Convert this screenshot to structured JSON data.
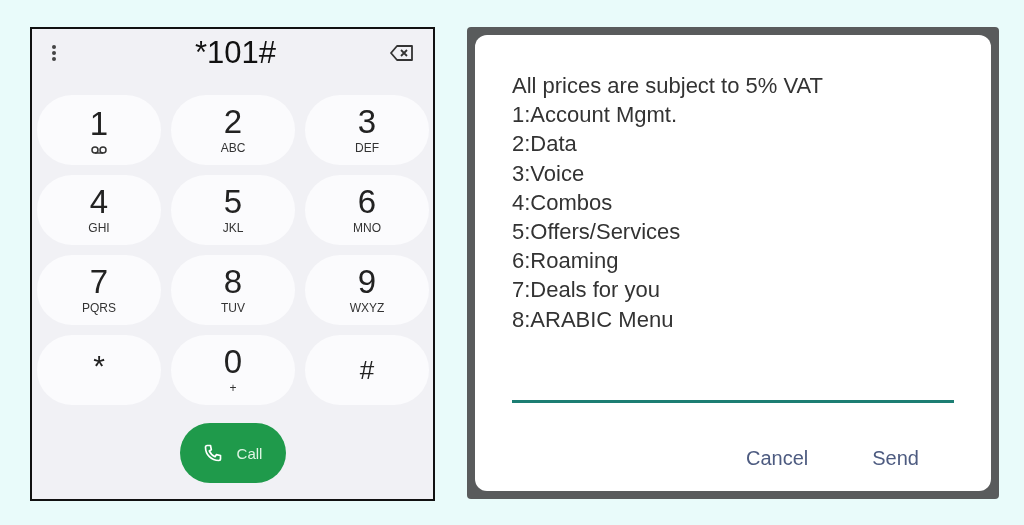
{
  "dialer": {
    "number": "*101#",
    "keys": [
      {
        "digit": "1",
        "kind": "voicemail"
      },
      {
        "digit": "2",
        "letters": "ABC",
        "kind": "letters"
      },
      {
        "digit": "3",
        "letters": "DEF",
        "kind": "letters"
      },
      {
        "digit": "4",
        "letters": "GHI",
        "kind": "letters"
      },
      {
        "digit": "5",
        "letters": "JKL",
        "kind": "letters"
      },
      {
        "digit": "6",
        "letters": "MNO",
        "kind": "letters"
      },
      {
        "digit": "7",
        "letters": "PQRS",
        "kind": "letters"
      },
      {
        "digit": "8",
        "letters": "TUV",
        "kind": "letters"
      },
      {
        "digit": "9",
        "letters": "WXYZ",
        "kind": "letters"
      },
      {
        "digit": "*",
        "kind": "symbol"
      },
      {
        "digit": "0",
        "letters": "+",
        "kind": "letters"
      },
      {
        "digit": "#",
        "kind": "symbol"
      }
    ],
    "call_label": "Call"
  },
  "ussd_dialog": {
    "lines": [
      "All prices are subject to 5% VAT",
      "1:Account Mgmt.",
      "2:Data",
      "3:Voice",
      "4:Combos",
      "5:Offers/Services",
      "6:Roaming",
      "7:Deals for you",
      "8:ARABIC Menu"
    ],
    "buttons": [
      "Cancel",
      "Send"
    ]
  }
}
